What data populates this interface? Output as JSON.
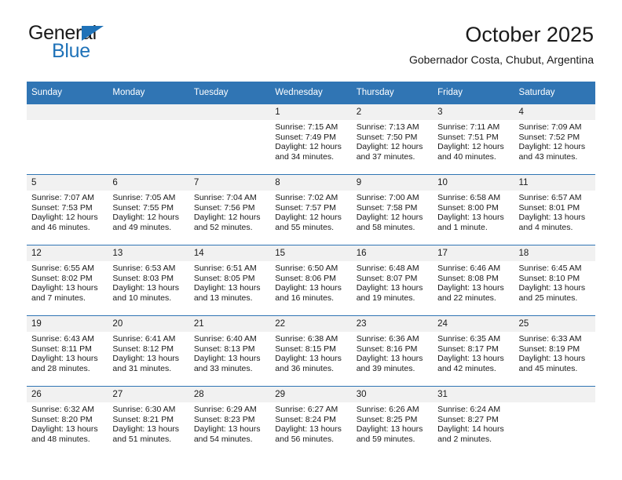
{
  "brand": {
    "name_part1": "General",
    "name_part2": "Blue",
    "triangle_color": "#1f72b8"
  },
  "header": {
    "title": "October 2025",
    "subtitle": "Gobernador Costa, Chubut, Argentina"
  },
  "theme": {
    "header_blue": "#3075b4",
    "daynum_band": "#f1f1f1",
    "text": "#1a1a1a"
  },
  "weekdays": [
    "Sunday",
    "Monday",
    "Tuesday",
    "Wednesday",
    "Thursday",
    "Friday",
    "Saturday"
  ],
  "weeks": [
    [
      {
        "day": "",
        "sunrise": "",
        "sunset": "",
        "daylight1": "",
        "daylight2": ""
      },
      {
        "day": "",
        "sunrise": "",
        "sunset": "",
        "daylight1": "",
        "daylight2": ""
      },
      {
        "day": "",
        "sunrise": "",
        "sunset": "",
        "daylight1": "",
        "daylight2": ""
      },
      {
        "day": "1",
        "sunrise": "Sunrise: 7:15 AM",
        "sunset": "Sunset: 7:49 PM",
        "daylight1": "Daylight: 12 hours",
        "daylight2": "and 34 minutes."
      },
      {
        "day": "2",
        "sunrise": "Sunrise: 7:13 AM",
        "sunset": "Sunset: 7:50 PM",
        "daylight1": "Daylight: 12 hours",
        "daylight2": "and 37 minutes."
      },
      {
        "day": "3",
        "sunrise": "Sunrise: 7:11 AM",
        "sunset": "Sunset: 7:51 PM",
        "daylight1": "Daylight: 12 hours",
        "daylight2": "and 40 minutes."
      },
      {
        "day": "4",
        "sunrise": "Sunrise: 7:09 AM",
        "sunset": "Sunset: 7:52 PM",
        "daylight1": "Daylight: 12 hours",
        "daylight2": "and 43 minutes."
      }
    ],
    [
      {
        "day": "5",
        "sunrise": "Sunrise: 7:07 AM",
        "sunset": "Sunset: 7:53 PM",
        "daylight1": "Daylight: 12 hours",
        "daylight2": "and 46 minutes."
      },
      {
        "day": "6",
        "sunrise": "Sunrise: 7:05 AM",
        "sunset": "Sunset: 7:55 PM",
        "daylight1": "Daylight: 12 hours",
        "daylight2": "and 49 minutes."
      },
      {
        "day": "7",
        "sunrise": "Sunrise: 7:04 AM",
        "sunset": "Sunset: 7:56 PM",
        "daylight1": "Daylight: 12 hours",
        "daylight2": "and 52 minutes."
      },
      {
        "day": "8",
        "sunrise": "Sunrise: 7:02 AM",
        "sunset": "Sunset: 7:57 PM",
        "daylight1": "Daylight: 12 hours",
        "daylight2": "and 55 minutes."
      },
      {
        "day": "9",
        "sunrise": "Sunrise: 7:00 AM",
        "sunset": "Sunset: 7:58 PM",
        "daylight1": "Daylight: 12 hours",
        "daylight2": "and 58 minutes."
      },
      {
        "day": "10",
        "sunrise": "Sunrise: 6:58 AM",
        "sunset": "Sunset: 8:00 PM",
        "daylight1": "Daylight: 13 hours",
        "daylight2": "and 1 minute."
      },
      {
        "day": "11",
        "sunrise": "Sunrise: 6:57 AM",
        "sunset": "Sunset: 8:01 PM",
        "daylight1": "Daylight: 13 hours",
        "daylight2": "and 4 minutes."
      }
    ],
    [
      {
        "day": "12",
        "sunrise": "Sunrise: 6:55 AM",
        "sunset": "Sunset: 8:02 PM",
        "daylight1": "Daylight: 13 hours",
        "daylight2": "and 7 minutes."
      },
      {
        "day": "13",
        "sunrise": "Sunrise: 6:53 AM",
        "sunset": "Sunset: 8:03 PM",
        "daylight1": "Daylight: 13 hours",
        "daylight2": "and 10 minutes."
      },
      {
        "day": "14",
        "sunrise": "Sunrise: 6:51 AM",
        "sunset": "Sunset: 8:05 PM",
        "daylight1": "Daylight: 13 hours",
        "daylight2": "and 13 minutes."
      },
      {
        "day": "15",
        "sunrise": "Sunrise: 6:50 AM",
        "sunset": "Sunset: 8:06 PM",
        "daylight1": "Daylight: 13 hours",
        "daylight2": "and 16 minutes."
      },
      {
        "day": "16",
        "sunrise": "Sunrise: 6:48 AM",
        "sunset": "Sunset: 8:07 PM",
        "daylight1": "Daylight: 13 hours",
        "daylight2": "and 19 minutes."
      },
      {
        "day": "17",
        "sunrise": "Sunrise: 6:46 AM",
        "sunset": "Sunset: 8:08 PM",
        "daylight1": "Daylight: 13 hours",
        "daylight2": "and 22 minutes."
      },
      {
        "day": "18",
        "sunrise": "Sunrise: 6:45 AM",
        "sunset": "Sunset: 8:10 PM",
        "daylight1": "Daylight: 13 hours",
        "daylight2": "and 25 minutes."
      }
    ],
    [
      {
        "day": "19",
        "sunrise": "Sunrise: 6:43 AM",
        "sunset": "Sunset: 8:11 PM",
        "daylight1": "Daylight: 13 hours",
        "daylight2": "and 28 minutes."
      },
      {
        "day": "20",
        "sunrise": "Sunrise: 6:41 AM",
        "sunset": "Sunset: 8:12 PM",
        "daylight1": "Daylight: 13 hours",
        "daylight2": "and 31 minutes."
      },
      {
        "day": "21",
        "sunrise": "Sunrise: 6:40 AM",
        "sunset": "Sunset: 8:13 PM",
        "daylight1": "Daylight: 13 hours",
        "daylight2": "and 33 minutes."
      },
      {
        "day": "22",
        "sunrise": "Sunrise: 6:38 AM",
        "sunset": "Sunset: 8:15 PM",
        "daylight1": "Daylight: 13 hours",
        "daylight2": "and 36 minutes."
      },
      {
        "day": "23",
        "sunrise": "Sunrise: 6:36 AM",
        "sunset": "Sunset: 8:16 PM",
        "daylight1": "Daylight: 13 hours",
        "daylight2": "and 39 minutes."
      },
      {
        "day": "24",
        "sunrise": "Sunrise: 6:35 AM",
        "sunset": "Sunset: 8:17 PM",
        "daylight1": "Daylight: 13 hours",
        "daylight2": "and 42 minutes."
      },
      {
        "day": "25",
        "sunrise": "Sunrise: 6:33 AM",
        "sunset": "Sunset: 8:19 PM",
        "daylight1": "Daylight: 13 hours",
        "daylight2": "and 45 minutes."
      }
    ],
    [
      {
        "day": "26",
        "sunrise": "Sunrise: 6:32 AM",
        "sunset": "Sunset: 8:20 PM",
        "daylight1": "Daylight: 13 hours",
        "daylight2": "and 48 minutes."
      },
      {
        "day": "27",
        "sunrise": "Sunrise: 6:30 AM",
        "sunset": "Sunset: 8:21 PM",
        "daylight1": "Daylight: 13 hours",
        "daylight2": "and 51 minutes."
      },
      {
        "day": "28",
        "sunrise": "Sunrise: 6:29 AM",
        "sunset": "Sunset: 8:23 PM",
        "daylight1": "Daylight: 13 hours",
        "daylight2": "and 54 minutes."
      },
      {
        "day": "29",
        "sunrise": "Sunrise: 6:27 AM",
        "sunset": "Sunset: 8:24 PM",
        "daylight1": "Daylight: 13 hours",
        "daylight2": "and 56 minutes."
      },
      {
        "day": "30",
        "sunrise": "Sunrise: 6:26 AM",
        "sunset": "Sunset: 8:25 PM",
        "daylight1": "Daylight: 13 hours",
        "daylight2": "and 59 minutes."
      },
      {
        "day": "31",
        "sunrise": "Sunrise: 6:24 AM",
        "sunset": "Sunset: 8:27 PM",
        "daylight1": "Daylight: 14 hours",
        "daylight2": "and 2 minutes."
      },
      {
        "day": "",
        "sunrise": "",
        "sunset": "",
        "daylight1": "",
        "daylight2": ""
      }
    ]
  ]
}
